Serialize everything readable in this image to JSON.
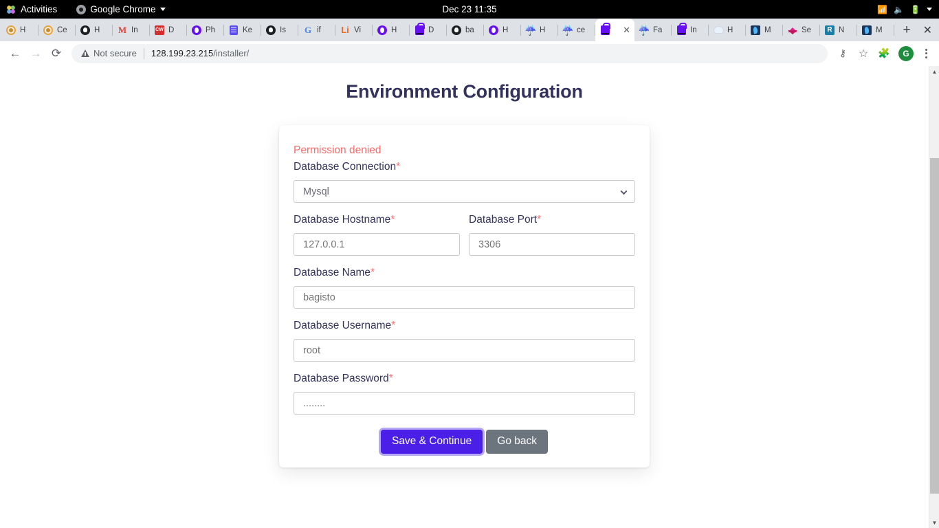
{
  "gnome": {
    "activities": "Activities",
    "app_menu": "Google Chrome",
    "clock": "Dec 23  11:35",
    "icons": [
      "wifi-icon",
      "volume-muted-icon",
      "battery-charging-icon",
      "chevron-down-icon"
    ]
  },
  "browser": {
    "tabs": [
      {
        "title": "H",
        "icon": "ring-orange-favicon",
        "active": false
      },
      {
        "title": "Ce",
        "icon": "ring-orange-favicon",
        "active": false
      },
      {
        "title": "H",
        "icon": "dark-bird-favicon",
        "active": false
      },
      {
        "title": "In",
        "icon": "gmail-favicon",
        "active": false
      },
      {
        "title": "D",
        "icon": "cw-red-favicon",
        "active": false
      },
      {
        "title": "Ph",
        "icon": "purple-circle-favicon",
        "active": false
      },
      {
        "title": "Ke",
        "icon": "purple-doc-favicon",
        "active": false
      },
      {
        "title": "Is",
        "icon": "github-favicon",
        "active": false
      },
      {
        "title": "if",
        "icon": "google-favicon",
        "active": false
      },
      {
        "title": "Vi",
        "icon": "linux-orange-favicon",
        "active": false
      },
      {
        "title": "H",
        "icon": "purple-circle-favicon",
        "active": false
      },
      {
        "title": "D",
        "icon": "bagisto-bag-favicon",
        "active": false
      },
      {
        "title": "ba",
        "icon": "github-favicon",
        "active": false
      },
      {
        "title": "H",
        "icon": "purple-circle-favicon",
        "active": false
      },
      {
        "title": "H",
        "icon": "java-favicon",
        "active": false
      },
      {
        "title": "ce",
        "icon": "java-favicon",
        "active": false
      },
      {
        "title": "",
        "icon": "bagisto-bag-favicon",
        "active": true,
        "close": "✕"
      },
      {
        "title": "Fa",
        "icon": "java-favicon",
        "active": false
      },
      {
        "title": "In",
        "icon": "bagisto-bag-favicon",
        "active": false
      },
      {
        "title": "H",
        "icon": "cloud-favicon",
        "active": false
      },
      {
        "title": "M",
        "icon": "mongodb-favicon",
        "active": false
      },
      {
        "title": "Se",
        "icon": "layers-pink-favicon",
        "active": false
      },
      {
        "title": "N",
        "icon": "r-teal-favicon",
        "active": false
      },
      {
        "title": "M",
        "icon": "mongodb-favicon",
        "active": false
      }
    ],
    "new_tab": "+",
    "window_close": "✕",
    "nav": {
      "back": "←",
      "forward": "→",
      "reload": "⟳"
    },
    "omnibox": {
      "security_label": "Not secure",
      "url_host": "128.199.23.215",
      "url_path": "/installer/"
    },
    "toolbar_icons": {
      "password_key": "⚷",
      "bookmark_star": "☆",
      "extensions_puzzle": "🧩",
      "profile_initial": "G"
    }
  },
  "page": {
    "title": "Environment Configuration",
    "alert": "Permission denied",
    "fields": {
      "connection": {
        "label": "Database Connection",
        "required": "*",
        "value": "Mysql",
        "options": [
          "Mysql"
        ]
      },
      "hostname": {
        "label": "Database Hostname",
        "required": "*",
        "placeholder": "127.0.0.1"
      },
      "port": {
        "label": "Database Port",
        "required": "*",
        "placeholder": "3306"
      },
      "dbname": {
        "label": "Database Name",
        "required": "*",
        "placeholder": "bagisto"
      },
      "username": {
        "label": "Database Username",
        "required": "*",
        "placeholder": "root"
      },
      "password": {
        "label": "Database Password",
        "required": "*",
        "placeholder": "........"
      }
    },
    "buttons": {
      "primary": "Save & Continue",
      "secondary": "Go back"
    }
  },
  "colors": {
    "primary": "#4b1fe8",
    "secondary": "#6c757d",
    "error": "#fc6b6b",
    "heading": "#32325d"
  }
}
